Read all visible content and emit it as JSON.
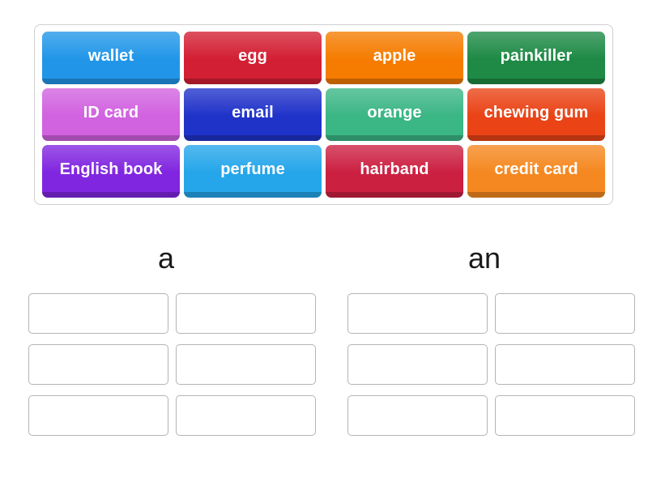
{
  "activity": {
    "type": "group-sort",
    "word_bank": {
      "tiles": [
        {
          "label": "wallet",
          "color": "#2196e8"
        },
        {
          "label": "egg",
          "color": "#d31f33"
        },
        {
          "label": "apple",
          "color": "#f57c00"
        },
        {
          "label": "painkiller",
          "color": "#1e8a45"
        },
        {
          "label": "ID card",
          "color": "#d162e0"
        },
        {
          "label": "email",
          "color": "#2033c9"
        },
        {
          "label": "orange",
          "color": "#3bb685"
        },
        {
          "label": "chewing gum",
          "color": "#ea4316"
        },
        {
          "label": "English book",
          "color": "#8126e0"
        },
        {
          "label": "perfume",
          "color": "#25a6ea"
        },
        {
          "label": "hairband",
          "color": "#cc2041"
        },
        {
          "label": "credit card",
          "color": "#f58820"
        }
      ]
    },
    "categories": [
      {
        "title": "a",
        "slots": [
          "",
          "",
          "",
          "",
          "",
          ""
        ]
      },
      {
        "title": "an",
        "slots": [
          "",
          "",
          "",
          "",
          "",
          ""
        ]
      }
    ]
  }
}
